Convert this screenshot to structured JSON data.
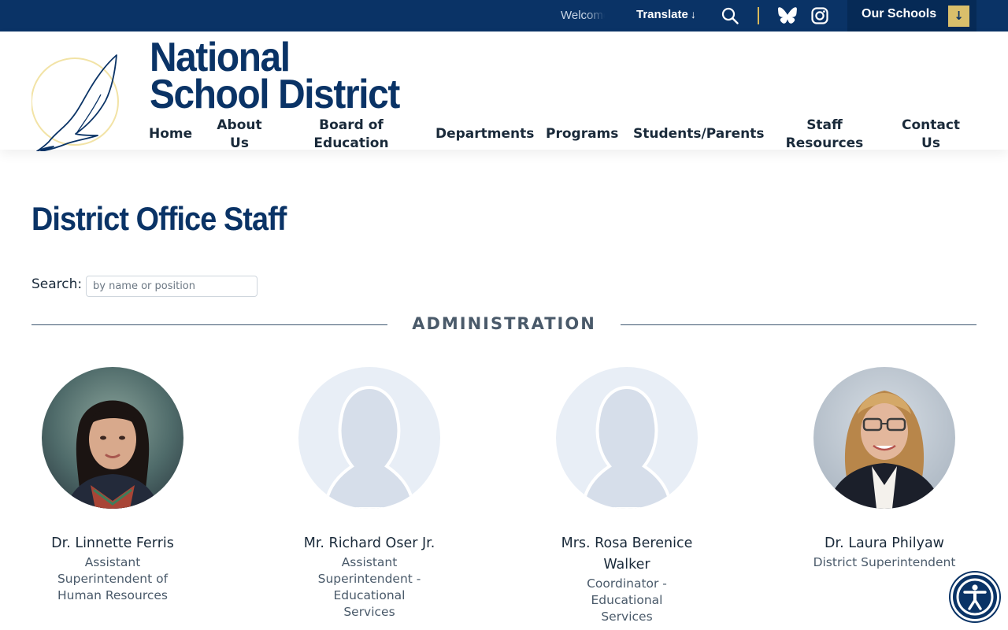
{
  "topbar": {
    "welcome_text": "Welcome",
    "translate_label": "Translate",
    "translate_arrow": "↓",
    "our_schools_label": "Our Schools",
    "our_schools_arrow": "↓",
    "icons": [
      "search-icon",
      "bluesky-icon",
      "instagram-icon"
    ]
  },
  "header": {
    "brand_line1": "National",
    "brand_line2": "School District",
    "nav": [
      {
        "label": "Home"
      },
      {
        "label": "About Us"
      },
      {
        "label": "Board of Education"
      },
      {
        "label": "Departments"
      },
      {
        "label": "Programs"
      },
      {
        "label": "Students/Parents"
      },
      {
        "label": "Staff Resources"
      },
      {
        "label": "Contact Us"
      }
    ]
  },
  "main": {
    "page_title": "District Office Staff",
    "search": {
      "label": "Search:",
      "placeholder": "by name or position",
      "value": ""
    },
    "section_title": "ADMINISTRATION",
    "staff": [
      {
        "name": "Dr. Linnette Ferris",
        "role": "Assistant Superintendent of Human Resources",
        "photo": "portrait"
      },
      {
        "name": "Mr. Richard Oser Jr.",
        "role": "Assistant Superintendent - Educational Services",
        "photo": "placeholder-silhouette"
      },
      {
        "name": "Mrs. Rosa Berenice Walker",
        "role": "Coordinator - Educational Services",
        "photo": "placeholder-silhouette"
      },
      {
        "name": "Dr. Laura Philyaw",
        "role": "District Superintendent",
        "photo": "portrait"
      }
    ]
  },
  "colors": {
    "brand_navy": "#0a3366",
    "accent_gold": "#d9bf6b",
    "placeholder_bg": "#e8eef6"
  },
  "accessibility_button_icon": "accessibility-icon"
}
